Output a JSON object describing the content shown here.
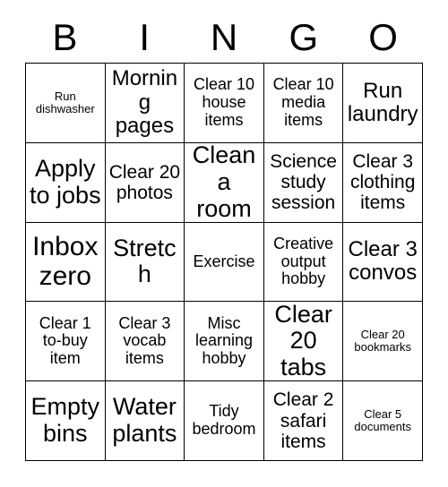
{
  "card": {
    "title": "BINGO",
    "header_letters": [
      "B",
      "I",
      "N",
      "G",
      "O"
    ],
    "columns": 5,
    "rows": 5,
    "text_color": "#000000",
    "background_color": "#ffffff",
    "border_color": "#000000"
  },
  "cells": [
    {
      "text": "Run dishwasher",
      "size": "fs-xs"
    },
    {
      "text": "Morning pages",
      "size": "fs-xl"
    },
    {
      "text": "Clear 10 house items",
      "size": "fs-md"
    },
    {
      "text": "Clear 10 media items",
      "size": "fs-md"
    },
    {
      "text": "Run laundry",
      "size": "fs-xl"
    },
    {
      "text": "Apply to jobs",
      "size": "fs-xxl"
    },
    {
      "text": "Clear 20 photos",
      "size": "fs-lg"
    },
    {
      "text": "Clean a room",
      "size": "fs-xxl"
    },
    {
      "text": "Science study session",
      "size": "fs-lg"
    },
    {
      "text": "Clear 3 clothing items",
      "size": "fs-lg"
    },
    {
      "text": "Inbox zero",
      "size": "fs-huge"
    },
    {
      "text": "Stretch",
      "size": "fs-xxl"
    },
    {
      "text": "Exercise",
      "size": "fs-md"
    },
    {
      "text": "Creative output hobby",
      "size": "fs-md"
    },
    {
      "text": "Clear 3 convos",
      "size": "fs-xl"
    },
    {
      "text": "Clear 1 to-buy item",
      "size": "fs-md"
    },
    {
      "text": "Clear 3 vocab items",
      "size": "fs-md"
    },
    {
      "text": "Misc learning hobby",
      "size": "fs-md"
    },
    {
      "text": "Clear 20 tabs",
      "size": "fs-xxl"
    },
    {
      "text": "Clear 20 bookmarks",
      "size": "fs-xs"
    },
    {
      "text": "Empty bins",
      "size": "fs-xxl"
    },
    {
      "text": "Water plants",
      "size": "fs-xxl"
    },
    {
      "text": "Tidy bedroom",
      "size": "fs-md"
    },
    {
      "text": "Clear 2 safari items",
      "size": "fs-lg"
    },
    {
      "text": "Clear 5 documents",
      "size": "fs-xs"
    }
  ]
}
